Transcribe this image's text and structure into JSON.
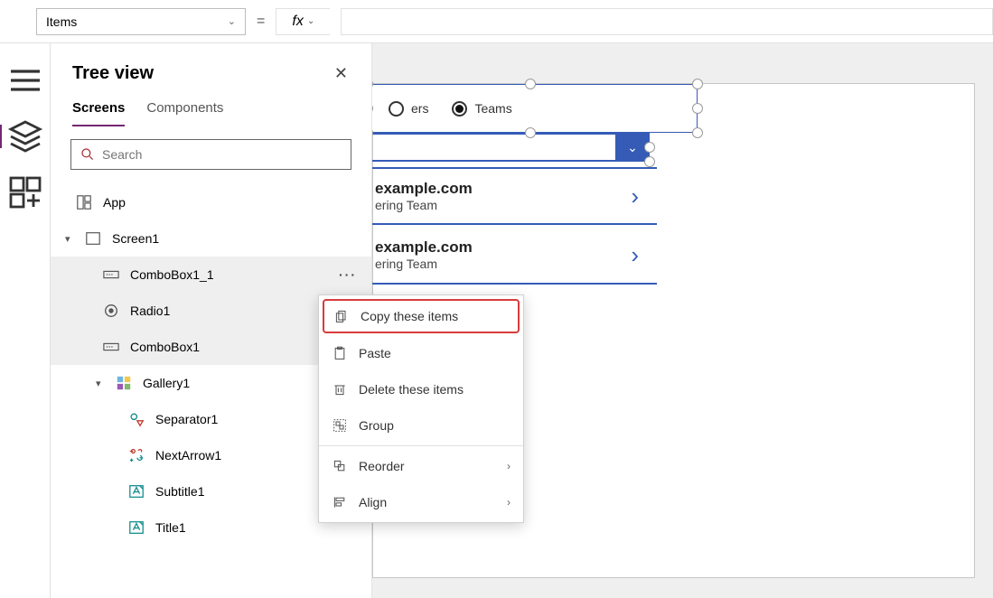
{
  "formula": {
    "property": "Items",
    "value": ""
  },
  "tree": {
    "title": "Tree view",
    "tabs": {
      "screens": "Screens",
      "components": "Components"
    },
    "search_placeholder": "Search",
    "app": "App",
    "screen": "Screen1",
    "items": {
      "combobox1_1": "ComboBox1_1",
      "radio1": "Radio1",
      "combobox1": "ComboBox1",
      "gallery1": "Gallery1",
      "separator1": "Separator1",
      "nextarrow1": "NextArrow1",
      "subtitle1": "Subtitle1",
      "title1": "Title1"
    }
  },
  "canvas": {
    "radio": {
      "option1_partial": "ers",
      "option2": "Teams"
    },
    "gallery_rows": [
      {
        "title_partial": "example.com",
        "subtitle_partial": "ering Team"
      },
      {
        "title_partial": "example.com",
        "subtitle_partial": "ering Team"
      }
    ]
  },
  "context_menu": {
    "copy": "Copy these items",
    "paste": "Paste",
    "delete": "Delete these items",
    "group": "Group",
    "reorder": "Reorder",
    "align": "Align"
  }
}
